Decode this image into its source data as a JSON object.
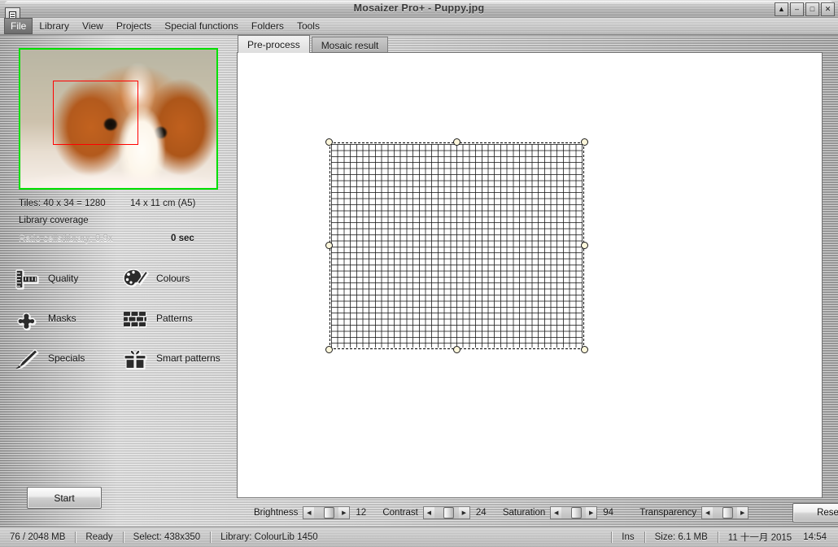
{
  "window": {
    "title": "Mosaizer Pro+ - Puppy.jpg",
    "system_icon": "window-menu-icon",
    "controls": [
      {
        "name": "rollup-button",
        "glyph": "▲"
      },
      {
        "name": "minimize-button",
        "glyph": "–"
      },
      {
        "name": "maximize-button",
        "glyph": "□"
      },
      {
        "name": "close-button",
        "glyph": "✕"
      }
    ]
  },
  "menubar": {
    "items": [
      {
        "label": "File",
        "active": true
      },
      {
        "label": "Library",
        "active": false
      },
      {
        "label": "View",
        "active": false
      },
      {
        "label": "Projects",
        "active": false
      },
      {
        "label": "Special functions",
        "active": false
      },
      {
        "label": "Folders",
        "active": false
      },
      {
        "label": "Tools",
        "active": false
      }
    ]
  },
  "tabs": [
    {
      "label": "Pre-process",
      "selected": true
    },
    {
      "label": "Mosaic result",
      "selected": false
    }
  ],
  "left_panel": {
    "thumbnail_alt": "puppy-thumbnail",
    "info": {
      "tiles": "Tiles: 40 x 34 = 1280",
      "print_size": "14 x 11 cm  (A5)",
      "coverage": "Library coverage",
      "ratio": "Ratio cells/library: 0.9x",
      "seconds": "0 sec"
    },
    "tools": [
      {
        "label": "Quality",
        "icon": "ruler-icon"
      },
      {
        "label": "Colours",
        "icon": "palette-icon"
      },
      {
        "label": "Masks",
        "icon": "puzzle-piece-icon"
      },
      {
        "label": "Patterns",
        "icon": "brick-wall-icon"
      },
      {
        "label": "Specials",
        "icon": "paintbrush-icon"
      },
      {
        "label": "Smart patterns",
        "icon": "gift-box-icon"
      }
    ],
    "start_button": "Start"
  },
  "adjustments": {
    "brightness": {
      "label": "Brightness",
      "value": "12"
    },
    "contrast": {
      "label": "Contrast",
      "value": "24"
    },
    "saturation": {
      "label": "Saturation",
      "value": "94"
    },
    "transparency": {
      "label": "Transparency",
      "value": ""
    },
    "reset_button": "Reset"
  },
  "statusbar": {
    "memory": "76 / 2048 MB",
    "state": "Ready",
    "selection": "Select: 438x350",
    "library": "Library: ColourLib 1450",
    "insert_mode": "Ins",
    "file_size": "Size: 6.1 MB",
    "date": "11 十一月 2015",
    "time": "14:54"
  },
  "colors": {
    "thumbnail_frame": "#00e000",
    "thumbnail_selection": "#ff0000",
    "panel_background": "#c0c0c0",
    "handle_fill": "#fdf7dc"
  }
}
